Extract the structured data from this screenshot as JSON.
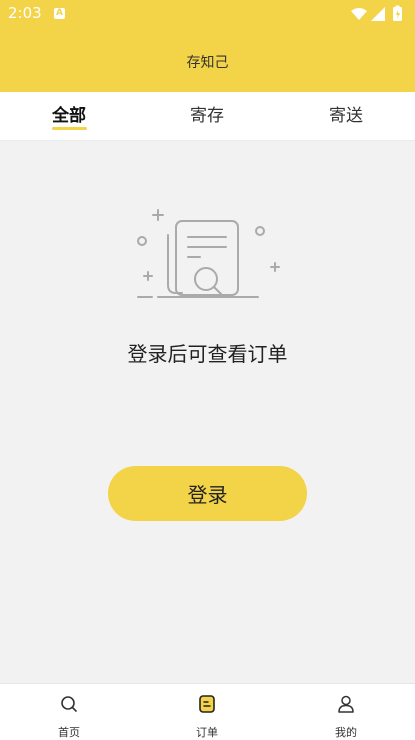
{
  "status_bar": {
    "time": "2:03",
    "notification_badge": "A"
  },
  "header": {
    "title": "存知己"
  },
  "tabs": [
    {
      "label": "全部",
      "active": true
    },
    {
      "label": "寄存",
      "active": false
    },
    {
      "label": "寄送",
      "active": false
    }
  ],
  "empty_state": {
    "message": "登录后可查看订单",
    "icon": "document-search-icon"
  },
  "login_button": {
    "label": "登录"
  },
  "bottom_nav": [
    {
      "label": "首页",
      "icon": "search-icon",
      "active": false
    },
    {
      "label": "订单",
      "icon": "order-icon",
      "active": true
    },
    {
      "label": "我的",
      "icon": "user-icon",
      "active": false
    }
  ],
  "colors": {
    "brand": "#f3d348",
    "background": "#f2f2f2",
    "text": "#222222"
  }
}
